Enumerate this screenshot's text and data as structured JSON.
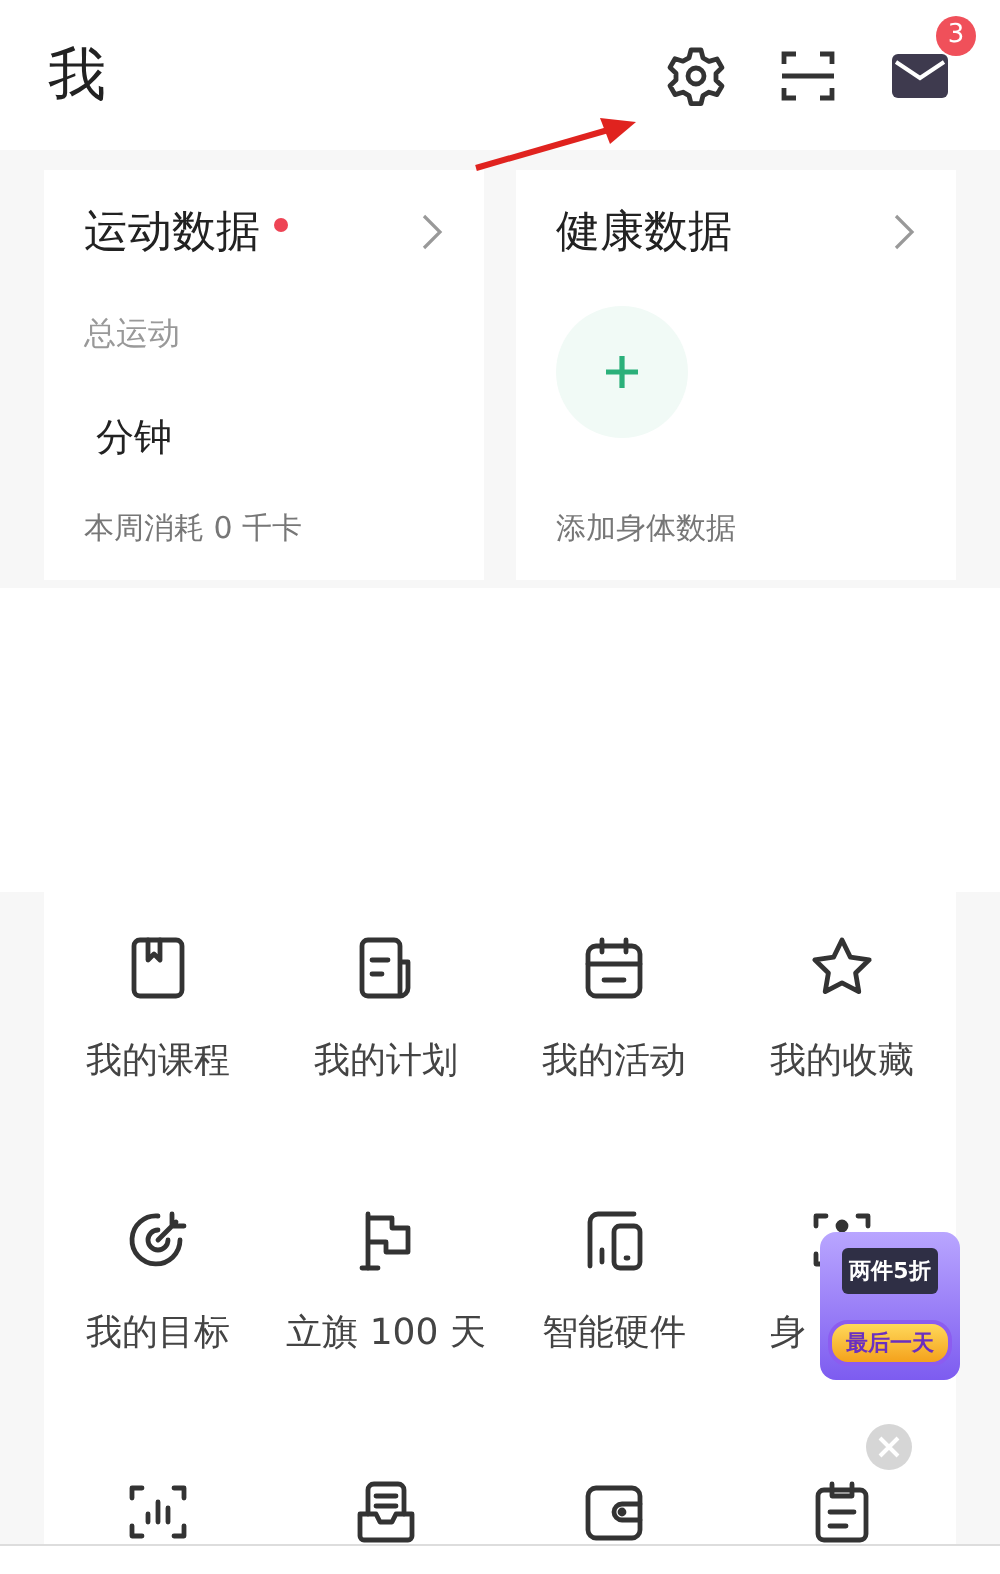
{
  "header": {
    "title": "我",
    "message_badge": "3"
  },
  "cards": [
    {
      "kind": "sport",
      "title": "运动数据",
      "dot": true,
      "subtitle": "总运动",
      "value": "分钟",
      "footer": "本周消耗 0 千卡"
    },
    {
      "kind": "health",
      "title": "健康数据",
      "dot": false,
      "footer": "添加身体数据"
    }
  ],
  "menu": [
    {
      "kind": "labeled",
      "label": "我的课程"
    },
    {
      "kind": "labeled",
      "label": "我的计划"
    },
    {
      "kind": "labeled",
      "label": "我的活动"
    },
    {
      "kind": "labeled",
      "label": "我的收藏"
    },
    {
      "kind": "labeled",
      "label": "我的目标"
    },
    {
      "kind": "labeled",
      "label": "立旗 100 天"
    },
    {
      "kind": "labeled",
      "label": "智能硬件"
    },
    {
      "kind": "labeled",
      "label": "身"
    },
    {
      "kind": "cut"
    },
    {
      "kind": "cut"
    },
    {
      "kind": "cut"
    },
    {
      "kind": "cut"
    }
  ],
  "promo": {
    "headline": "两件5折",
    "button": "最后一天"
  }
}
